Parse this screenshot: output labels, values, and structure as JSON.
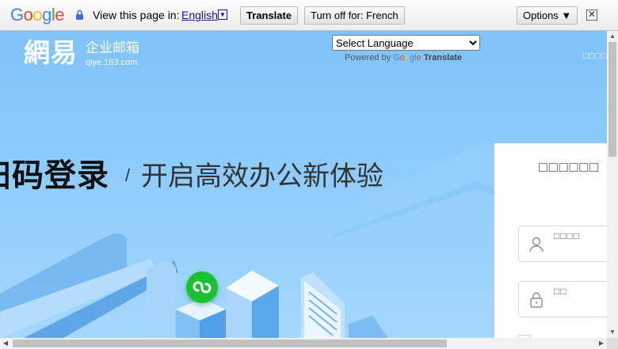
{
  "translate_bar": {
    "logo_letters": [
      {
        "ch": "G",
        "color": "#4285f4"
      },
      {
        "ch": "o",
        "color": "#ea4335"
      },
      {
        "ch": "o",
        "color": "#fbbc05"
      },
      {
        "ch": "g",
        "color": "#4285f4"
      },
      {
        "ch": "l",
        "color": "#34a853"
      },
      {
        "ch": "e",
        "color": "#ea4335"
      }
    ],
    "view_label": "View this page in:",
    "language": "English",
    "dropdown_glyph": "▼",
    "translate_button": "Translate",
    "turn_off_button": "Turn off for: French",
    "options_button": "Options ▼",
    "close_glyph": "✕"
  },
  "brand": {
    "logo_text": "網易",
    "product_name": "企业邮箱",
    "domain": "qiye.163.com"
  },
  "language_widget": {
    "select_value": "Select Language",
    "powered_by": "Powered by",
    "google_letters": [
      {
        "ch": "G",
        "color": "#4285f4"
      },
      {
        "ch": "o",
        "color": "#ea4335"
      },
      {
        "ch": "o",
        "color": "#fbbc05"
      },
      {
        "ch": "g",
        "color": "#4285f4"
      },
      {
        "ch": "l",
        "color": "#34a853"
      },
      {
        "ch": "e",
        "color": "#ea4335"
      }
    ],
    "translate_word": "Translate"
  },
  "top_right_links": "□□□□",
  "hero": {
    "bold_text": "扫码登录",
    "slash": "/",
    "tagline": "开启高效办公新体验"
  },
  "login": {
    "title": "□□□□□□",
    "username_placeholder": "□□□□",
    "password_placeholder": "□□"
  },
  "scrollbars": {
    "up": "▲",
    "down": "▼",
    "left": "◀",
    "right": "▶"
  },
  "colors": {
    "page_bg": "#8ccbfb",
    "mini_program_green": "#19c32f",
    "link_blue": "#1a0dab"
  }
}
